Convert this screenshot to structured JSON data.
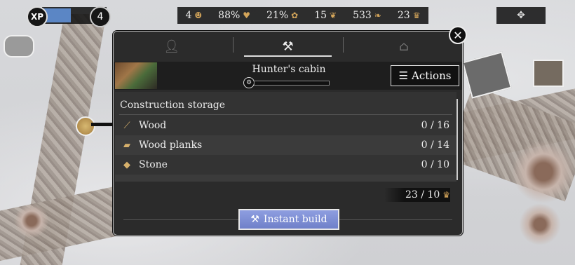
{
  "hud": {
    "xp_badge": "XP",
    "xp_progress": 0.45,
    "level": "4",
    "resources": [
      {
        "value": "4",
        "icon": "villager-icon"
      },
      {
        "value": "88%",
        "icon": "health-icon"
      },
      {
        "value": "21%",
        "icon": "happiness-icon"
      },
      {
        "value": "15",
        "icon": "food-icon"
      },
      {
        "value": "533",
        "icon": "coins-icon"
      },
      {
        "value": "23",
        "icon": "crown-icon"
      }
    ]
  },
  "dialog": {
    "tabs": [
      {
        "icon": "person-icon",
        "active": false
      },
      {
        "icon": "build-hammer-icon",
        "active": true
      },
      {
        "icon": "house-icon",
        "active": false
      }
    ],
    "building_name": "Hunter's cabin",
    "build_progress": 0,
    "actions_label": "Actions",
    "storage_title": "Construction storage",
    "items": [
      {
        "name": "Wood",
        "value": "0 / 16"
      },
      {
        "name": "Wood planks",
        "value": "0 / 14"
      },
      {
        "name": "Stone",
        "value": "0 / 10"
      }
    ],
    "cost_value": "23 / 10",
    "instant_build_label": "Instant build"
  },
  "colors": {
    "xp_fill": "#5b86c5",
    "instant_button": "#7a8bd4",
    "resource_icon": "#d4a55a"
  }
}
